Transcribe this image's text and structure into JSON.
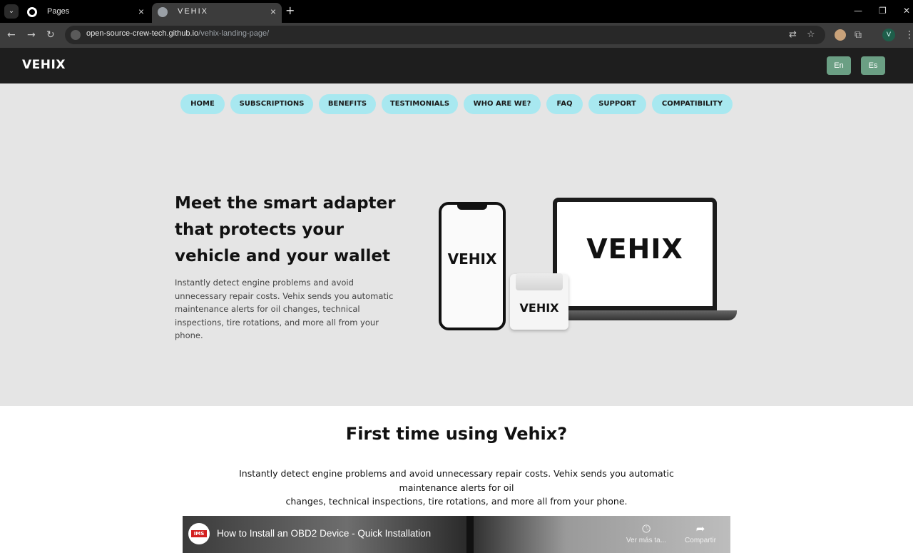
{
  "browser": {
    "tabs": [
      {
        "title": "Pages",
        "icon": "github-icon"
      },
      {
        "title": "VEHIX",
        "icon": "globe-icon"
      }
    ],
    "tab_close": "×",
    "new_tab": "+",
    "url_host": "open-source-crew-tech.github.io",
    "url_path": "/vehix-landing-page/",
    "profile_initial": "V",
    "window": {
      "minimize": "—",
      "restore": "❐",
      "close": "✕"
    }
  },
  "header": {
    "logo": "VEHIX",
    "lang_en": "En",
    "lang_es": "Es"
  },
  "nav": {
    "items": [
      "HOME",
      "SUBSCRIPTIONS",
      "BENEFITS",
      "TESTIMONIALS",
      "WHO ARE WE?",
      "FAQ",
      "SUPPORT",
      "COMPATIBILITY"
    ]
  },
  "hero": {
    "title": "Meet the smart adapter that protects your vehicle and your wallet",
    "text": "Instantly detect engine problems and avoid unnecessary repair costs. Vehix sends you automatic maintenance alerts for oil changes, technical inspections, tire rotations, and more all from your phone.",
    "device_label": "VEHIX"
  },
  "first_time": {
    "title": "First time using Vehix?",
    "line1": "Instantly detect engine problems and avoid unnecessary repair costs. Vehix sends you automatic",
    "line2": "maintenance alerts for oil",
    "line3": "changes, technical inspections, tire rotations, and more all from your phone."
  },
  "video": {
    "channel_badge": "IMS",
    "title": "How to Install an OBD2 Device - Quick Installation",
    "watch_later": "Ver más ta...",
    "share": "Compartir"
  },
  "colors": {
    "header_bg": "#1e1e1e",
    "hero_bg": "#e5e5e5",
    "nav_pill": "#a8e8f0",
    "lang_button": "#6b9f84"
  }
}
